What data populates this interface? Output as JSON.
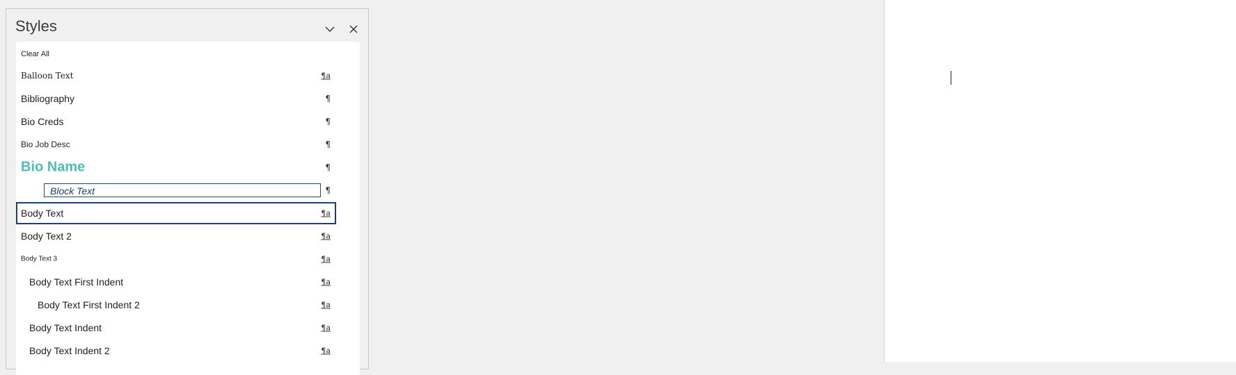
{
  "pane": {
    "title": "Styles",
    "collapse_icon": "chevron-down-icon",
    "close_icon": "close-icon"
  },
  "styles": [
    {
      "label": "Clear All",
      "mark": ""
    },
    {
      "label": "Balloon Text",
      "mark": "¶a"
    },
    {
      "label": "Bibliography",
      "mark": "¶"
    },
    {
      "label": "Bio Creds",
      "mark": "¶"
    },
    {
      "label": "Bio Job Desc",
      "mark": "¶"
    },
    {
      "label": "Bio Name",
      "mark": "¶"
    },
    {
      "label": "Block Text",
      "mark": "¶"
    },
    {
      "label": "Body Text",
      "mark": "¶a",
      "selected": true
    },
    {
      "label": "Body Text 2",
      "mark": "¶a"
    },
    {
      "label": "Body Text 3",
      "mark": "¶a"
    },
    {
      "label": "Body Text First Indent",
      "mark": "¶a"
    },
    {
      "label": "Body Text First Indent 2",
      "mark": "¶a"
    },
    {
      "label": "Body Text Indent",
      "mark": "¶a"
    },
    {
      "label": "Body Text Indent 2",
      "mark": "¶a"
    }
  ],
  "colors": {
    "bio_name": "#4dbfb2",
    "selection_border": "#1e3e78"
  }
}
